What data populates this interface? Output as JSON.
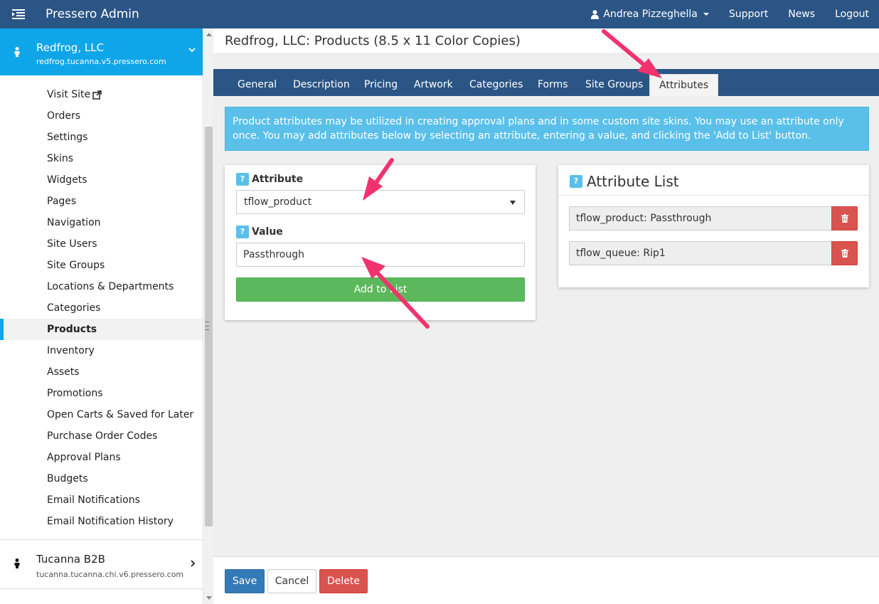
{
  "topbar": {
    "app_title": "Pressero Admin",
    "user_name": "Andrea Pizzeghella",
    "support": "Support",
    "news": "News",
    "logout": "Logout"
  },
  "sidebar": {
    "current_site": {
      "name": "Redfrog, LLC",
      "url": "redfrog.tucanna.v5.pressero.com"
    },
    "items": [
      "Visit Site",
      "Orders",
      "Settings",
      "Skins",
      "Widgets",
      "Pages",
      "Navigation",
      "Site Users",
      "Site Groups",
      "Locations & Departments",
      "Categories",
      "Products",
      "Inventory",
      "Assets",
      "Promotions",
      "Open Carts & Saved for Later",
      "Purchase Order Codes",
      "Approval Plans",
      "Budgets",
      "Email Notifications",
      "Email Notification History"
    ],
    "active_item": "Products",
    "other_site": {
      "name": "Tucanna B2B",
      "url": "tucanna.tucanna.chi.v6.pressero.com"
    }
  },
  "page": {
    "title": "Redfrog, LLC: Products (8.5 x 11 Color Copies)"
  },
  "tabs": [
    "General",
    "Description",
    "Pricing",
    "Artwork",
    "Categories",
    "Forms",
    "Site Groups",
    "Attributes"
  ],
  "active_tab": "Attributes",
  "info": {
    "text": "Product attributes may be utilized in creating approval plans and in some custom site skins. You may use an attribute only once. You may add attributes below by selecting an attribute, entering a value, and clicking the 'Add to List' button."
  },
  "form": {
    "help_glyph": "?",
    "attribute_label": "Attribute",
    "attribute_selected": "tflow_product",
    "value_label": "Value",
    "value_text": "Passthrough",
    "add_button": "Add to List"
  },
  "attribute_list": {
    "title": "Attribute List",
    "items": [
      "tflow_product: Passthrough",
      "tflow_queue: Rip1"
    ]
  },
  "footer": {
    "save": "Save",
    "cancel": "Cancel",
    "delete": "Delete"
  },
  "colors": {
    "topbar": "#2a5585",
    "site_header": "#0ea6e8",
    "info_box": "#5bc0e9",
    "success": "#5cb85c",
    "danger": "#d9534f",
    "primary": "#337ab7",
    "annotation_arrow": "#f0336e"
  }
}
